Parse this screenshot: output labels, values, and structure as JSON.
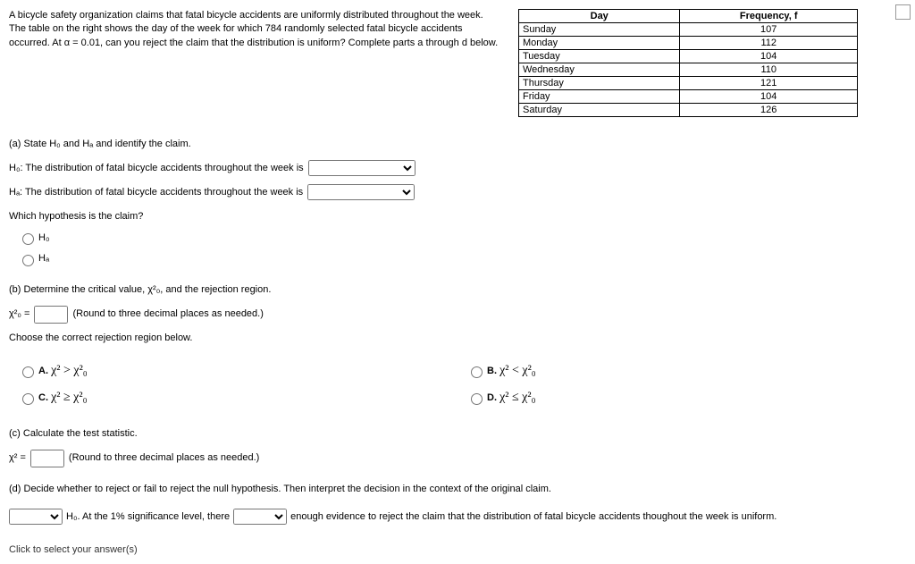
{
  "problem_text": "A bicycle safety organization claims that fatal bicycle accidents are uniformly distributed throughout the week. The table on the right shows the day of the week for which 784 randomly selected fatal bicycle accidents occurred. At α = 0.01, can you reject the claim that the distribution is uniform? Complete parts a through d below.",
  "table": {
    "header_day": "Day",
    "header_freq": "Frequency, f",
    "rows": [
      {
        "day": "Sunday",
        "freq": "107"
      },
      {
        "day": "Monday",
        "freq": "112"
      },
      {
        "day": "Tuesday",
        "freq": "104"
      },
      {
        "day": "Wednesday",
        "freq": "110"
      },
      {
        "day": "Thursday",
        "freq": "121"
      },
      {
        "day": "Friday",
        "freq": "104"
      },
      {
        "day": "Saturday",
        "freq": "126"
      }
    ]
  },
  "part_a": {
    "title": "(a) State H₀ and Hₐ and identify the claim.",
    "h0_prefix": "H₀: The distribution of fatal bicycle accidents throughout the week is",
    "ha_prefix": "Hₐ: The distribution of fatal bicycle accidents throughout the week is",
    "which_claim": "Which hypothesis is the claim?",
    "opt_h0": "H₀",
    "opt_ha": "Hₐ"
  },
  "part_b": {
    "title": "(b) Determine the critical value, χ²₀, and the rejection region.",
    "chi_label": "χ²₀ =",
    "round_note": "(Round to three decimal places as needed.)",
    "choose_label": "Choose the correct rejection region below.",
    "opt_a": "A.",
    "opt_a_expr": "χ² > χ²₀",
    "opt_b": "B.",
    "opt_b_expr": "χ² < χ²₀",
    "opt_c": "C.",
    "opt_c_expr": "χ² ≥ χ²₀",
    "opt_d": "D.",
    "opt_d_expr": "χ² ≤ χ²₀"
  },
  "part_c": {
    "title": "(c) Calculate the test statistic.",
    "chi_label": "χ² =",
    "round_note": "(Round to three decimal places as needed.)"
  },
  "part_d": {
    "title": "(d) Decide whether to reject or fail to reject the null hypothesis. Then interpret the decision in the context of the original claim.",
    "text1": "H₀. At the 1% significance level, there",
    "text2": "enough evidence to reject the claim that the distribution of fatal bicycle accidents thoughout the week is uniform."
  },
  "cutoff_text": "Click to select your answer(s)"
}
